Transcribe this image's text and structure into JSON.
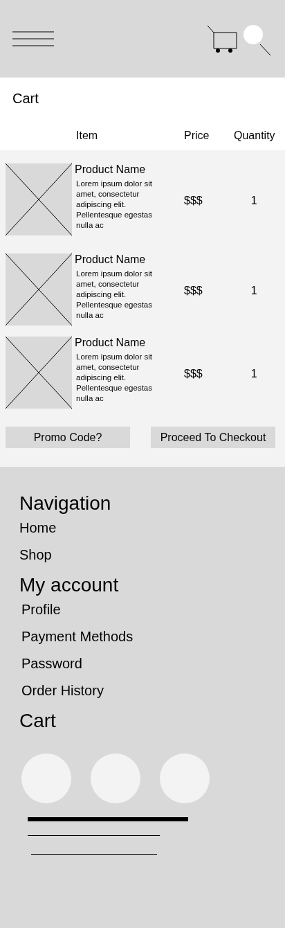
{
  "cart": {
    "title": "Cart",
    "columns": [
      "Item",
      "Price",
      "Quantity"
    ],
    "items": [
      {
        "name": "Product Name",
        "description": "Lorem ipsum dolor sit amet, consectetur adipiscing elit. Pellentesque egestas nulla ac",
        "price": "$$$",
        "quantity": "1"
      },
      {
        "name": "Product Name",
        "description": "Lorem ipsum dolor sit amet, consectetur adipiscing elit. Pellentesque egestas nulla ac",
        "price": "$$$",
        "quantity": "1"
      },
      {
        "name": "Product Name",
        "description": "Lorem ipsum dolor sit amet, consectetur adipiscing elit. Pellentesque egestas nulla ac",
        "price": "$$$",
        "quantity": "1"
      }
    ],
    "buttons": [
      "Promo Code?",
      "Proceed To Checkout"
    ]
  },
  "footer": {
    "sections": [
      {
        "title": "Navigation",
        "links": [
          "Home",
          "Shop"
        ]
      },
      {
        "title": "My account",
        "links": [
          "Profile",
          "Payment Methods",
          "Password",
          "Order History"
        ]
      },
      {
        "title": "Cart"
      }
    ]
  }
}
